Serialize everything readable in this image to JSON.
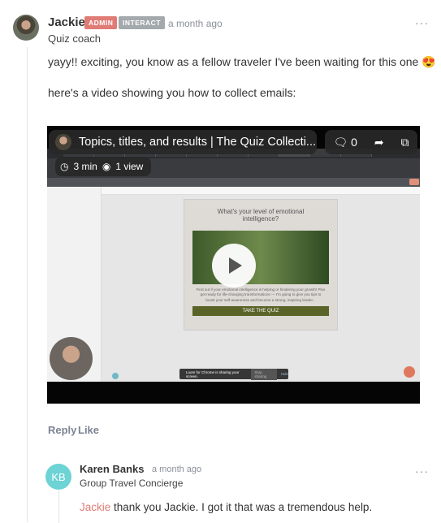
{
  "comment": {
    "author": "Jackie",
    "badges": [
      {
        "label": "ADMIN",
        "color": "#e07b76"
      },
      {
        "label": "INTERACT",
        "color": "#a3a9ac"
      }
    ],
    "time": "a month ago",
    "role": "Quiz coach",
    "paragraphs": [
      "yayy!! exciting, you know as a fellow traveler I've been waiting for this one 😍",
      "here's a video showing you how to collect emails:"
    ],
    "video": {
      "title": "Topics, titles, and results | The Quiz Collecti...",
      "comments_count": "0",
      "duration": "3 min",
      "views": "1 view",
      "quiz_heading": "What's your level of emotional intelligence?",
      "quiz_body": "Find out if your emotional intelligence is helping or hindering your growth! Plus get ready for life-changing transformations — I'm going to give you tips to boost your self-awareness and become a strong, inspiring leader...",
      "quiz_button": "TAKE THE QUIZ",
      "sharing_text": "Loom for Chrome is sharing your screen.",
      "stop_sharing": "Stop sharing",
      "hide": "Hide"
    },
    "actions": {
      "reply": "Reply",
      "like": "Like"
    }
  },
  "reply": {
    "initials": "KB",
    "avatar_color": "#6dd3d5",
    "author": "Karen Banks",
    "time": "a month ago",
    "role": "Group Travel Concierge",
    "mention": "Jackie",
    "mention_color": "#e07b76",
    "text": " thank you Jackie. I got it that was a tremendous help."
  }
}
